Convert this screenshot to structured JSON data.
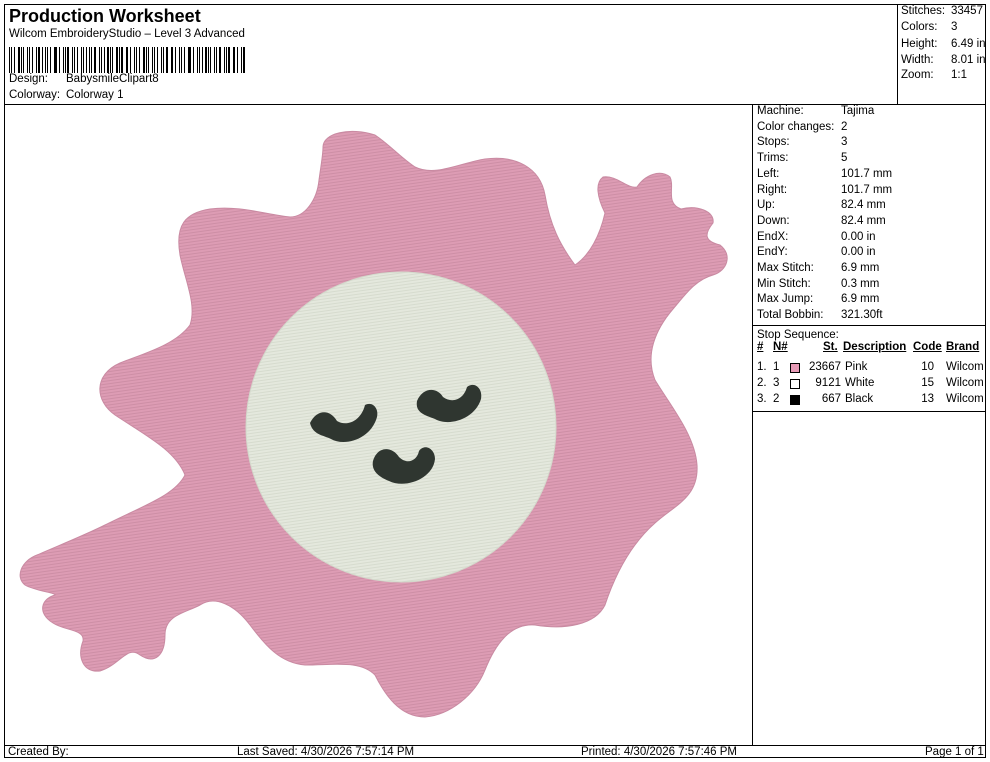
{
  "header": {
    "title": "Production Worksheet",
    "subtitle": "Wilcom EmbroideryStudio – Level 3 Advanced",
    "design_label": "Design:",
    "design_value": "BabysmileClipart8",
    "colorway_label": "Colorway:",
    "colorway_value": "Colorway 1"
  },
  "stats": {
    "stitches_label": "Stitches:",
    "stitches": "33457",
    "colors_label": "Colors:",
    "colors": "3",
    "height_label": "Height:",
    "height": "6.49 in",
    "width_label": "Width:",
    "width": "8.01 in",
    "zoom_label": "Zoom:",
    "zoom": "1:1"
  },
  "machine": {
    "rows": [
      {
        "k": "Machine:",
        "v": "Tajima"
      },
      {
        "k": "Color changes:",
        "v": "2"
      },
      {
        "k": "Stops:",
        "v": "3"
      },
      {
        "k": "Trims:",
        "v": "5"
      },
      {
        "k": "Left:",
        "v": "101.7 mm"
      },
      {
        "k": "Right:",
        "v": "101.7 mm"
      },
      {
        "k": "Up:",
        "v": "82.4 mm"
      },
      {
        "k": "Down:",
        "v": "82.4 mm"
      },
      {
        "k": "EndX:",
        "v": "0.00 in"
      },
      {
        "k": "EndY:",
        "v": "0.00 in"
      },
      {
        "k": "Max Stitch:",
        "v": "6.9 mm"
      },
      {
        "k": "Min Stitch:",
        "v": "0.3 mm"
      },
      {
        "k": "Max Jump:",
        "v": "6.9 mm"
      },
      {
        "k": "Total Bobbin:",
        "v": "321.30ft"
      }
    ]
  },
  "stop_sequence": {
    "title": "Stop Sequence:",
    "headers": {
      "num": "#",
      "n": "N#",
      "st": "St.",
      "desc": "Description",
      "code": "Code",
      "brand": "Brand"
    },
    "rows": [
      {
        "num": "1.",
        "n": "1",
        "color": "#e79ab6",
        "st": "23667",
        "desc": "Pink",
        "code": "10",
        "brand": "Wilcom"
      },
      {
        "num": "2.",
        "n": "3",
        "color": "#ffffff",
        "st": "9121",
        "desc": "White",
        "code": "15",
        "brand": "Wilcom"
      },
      {
        "num": "3.",
        "n": "2",
        "color": "#000000",
        "st": "667",
        "desc": "Black",
        "code": "13",
        "brand": "Wilcom"
      }
    ]
  },
  "design_colors": {
    "pink": "#dd9cb4",
    "pink_dark": "#c98aa2",
    "face": "#e4e8dd",
    "eyes": "#2f3630"
  },
  "footer": {
    "created": "Created By:",
    "saved": "Last Saved: 4/30/2026 7:57:14 PM",
    "printed": "Printed: 4/30/2026 7:57:46 PM",
    "page": "Page 1 of 1"
  }
}
